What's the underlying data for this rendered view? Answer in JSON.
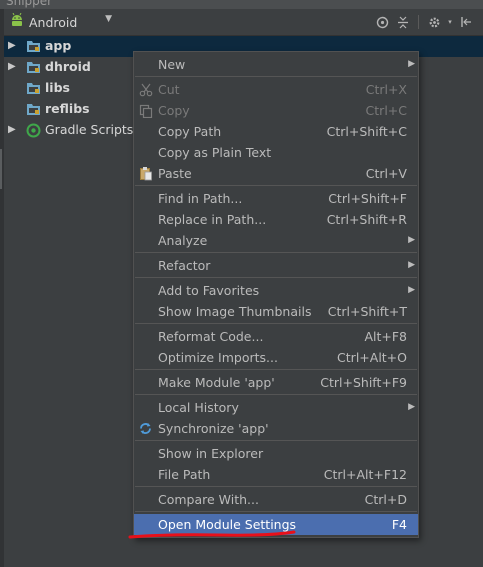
{
  "window": {
    "title": "Snipper"
  },
  "toolbar": {
    "view_selector": {
      "label": "Android"
    },
    "icons": [
      "crosshair-icon",
      "collapse-all-icon",
      "gear-icon",
      "hide-panel-icon"
    ]
  },
  "tree": {
    "items": [
      {
        "label": "app",
        "icon": "module-folder-icon",
        "expandable": true,
        "selected": true
      },
      {
        "label": "dhroid",
        "icon": "module-folder-icon",
        "expandable": true,
        "selected": false
      },
      {
        "label": "libs",
        "icon": "module-folder-icon",
        "expandable": false,
        "selected": false
      },
      {
        "label": "reflibs",
        "icon": "module-folder-icon",
        "expandable": false,
        "selected": false
      },
      {
        "label": "Gradle Scripts",
        "icon": "gradle-icon",
        "expandable": true,
        "selected": false
      }
    ]
  },
  "context_menu": {
    "groups": [
      [
        {
          "label": "New",
          "submenu": true
        }
      ],
      [
        {
          "label": "Cut",
          "shortcut": "Ctrl+X",
          "icon": "scissors-icon",
          "disabled": true
        },
        {
          "label": "Copy",
          "shortcut": "Ctrl+C",
          "icon": "copy-icon",
          "disabled": true
        },
        {
          "label": "Copy Path",
          "shortcut": "Ctrl+Shift+C"
        },
        {
          "label": "Copy as Plain Text"
        },
        {
          "label": "Paste",
          "shortcut": "Ctrl+V",
          "icon": "clipboard-icon"
        }
      ],
      [
        {
          "label": "Find in Path...",
          "shortcut": "Ctrl+Shift+F"
        },
        {
          "label": "Replace in Path...",
          "shortcut": "Ctrl+Shift+R"
        },
        {
          "label": "Analyze",
          "submenu": true
        }
      ],
      [
        {
          "label": "Refactor",
          "submenu": true
        }
      ],
      [
        {
          "label": "Add to Favorites",
          "submenu": true
        },
        {
          "label": "Show Image Thumbnails",
          "shortcut": "Ctrl+Shift+T"
        }
      ],
      [
        {
          "label": "Reformat Code...",
          "shortcut": "Alt+F8"
        },
        {
          "label": "Optimize Imports...",
          "shortcut": "Ctrl+Alt+O"
        }
      ],
      [
        {
          "label": "Make Module 'app'",
          "shortcut": "Ctrl+Shift+F9"
        }
      ],
      [
        {
          "label": "Local History",
          "submenu": true
        },
        {
          "label": "Synchronize 'app'",
          "icon": "sync-icon"
        }
      ],
      [
        {
          "label": "Show in Explorer"
        },
        {
          "label": "File Path",
          "shortcut": "Ctrl+Alt+F12"
        }
      ],
      [
        {
          "label": "Compare With...",
          "shortcut": "Ctrl+D"
        }
      ],
      [
        {
          "label": "Open Module Settings",
          "shortcut": "F4",
          "highlighted": true
        }
      ]
    ]
  },
  "colors": {
    "background": "#3c3f41",
    "selection": "#0d293e",
    "menu_highlight": "#4b6eaf",
    "annotation": "#e8101a"
  }
}
